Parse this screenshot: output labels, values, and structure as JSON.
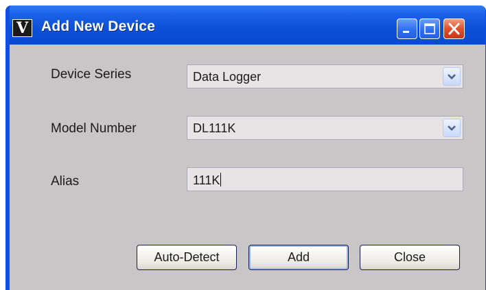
{
  "window": {
    "title": "Add New Device",
    "app_icon_glyph": "V",
    "accent_color": "#0a49cf"
  },
  "form": {
    "device_series": {
      "label": "Device Series",
      "value": "Data Logger"
    },
    "model_number": {
      "label": "Model Number",
      "value": "DL111K"
    },
    "alias": {
      "label": "Alias",
      "value": "111K"
    }
  },
  "buttons": {
    "auto_detect": "Auto-Detect",
    "add": "Add",
    "close": "Close"
  },
  "icons": [
    "app-logo-icon",
    "minimize-icon",
    "maximize-icon",
    "close-icon",
    "chevron-down-icon"
  ]
}
